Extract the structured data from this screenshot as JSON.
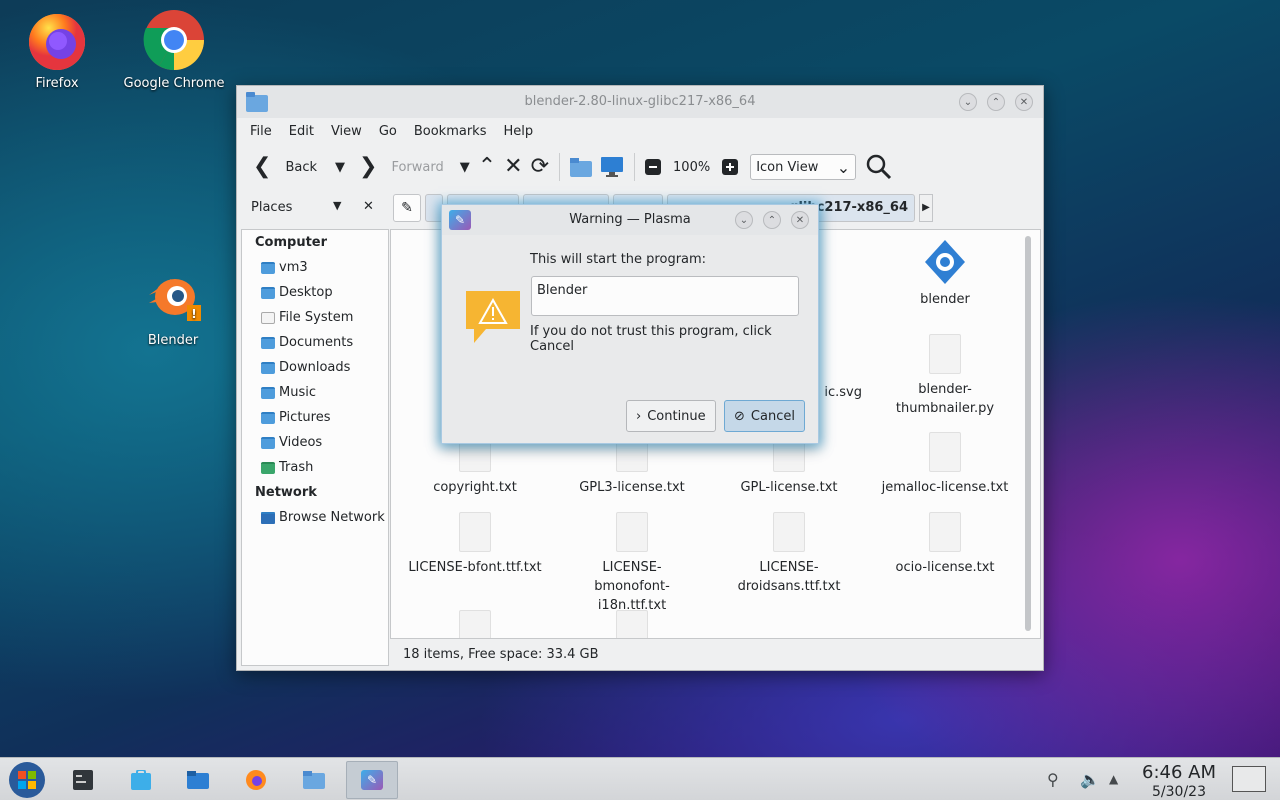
{
  "desktop": {
    "icons": [
      {
        "label": "Firefox"
      },
      {
        "label": "Google Chrome"
      },
      {
        "label": "Blender"
      }
    ]
  },
  "window": {
    "title": "blender-2.80-linux-glibc217-x86_64",
    "menu": [
      "File",
      "Edit",
      "View",
      "Go",
      "Bookmarks",
      "Help"
    ],
    "toolbar": {
      "back": "Back",
      "forward": "Forward",
      "zoom": "100%",
      "view_mode": "Icon View"
    },
    "places": {
      "header": "Places",
      "sections": [
        {
          "title": "Computer",
          "items": [
            "vm3",
            "Desktop",
            "File System",
            "Documents",
            "Downloads",
            "Music",
            "Pictures",
            "Videos",
            "Trash"
          ]
        },
        {
          "title": "Network",
          "items": [
            "Browse Network"
          ]
        }
      ]
    },
    "breadcrumb_tail": "glibc217-x86_64",
    "files": [
      {
        "name": "blender"
      },
      {
        "name": "ic.svg"
      },
      {
        "name": "blender-thumbnailer.py"
      },
      {
        "name": "copyright.txt"
      },
      {
        "name": "GPL3-license.txt"
      },
      {
        "name": "GPL-license.txt"
      },
      {
        "name": "jemalloc-license.txt"
      },
      {
        "name": "LICENSE-bfont.ttf.txt"
      },
      {
        "name": "LICENSE-bmonofont-i18n.ttf.txt"
      },
      {
        "name": "LICENSE-droidsans.ttf.txt"
      },
      {
        "name": "ocio-license.txt"
      }
    ],
    "status": "18 items, Free space: 33.4 GB"
  },
  "dialog": {
    "title": "Warning — Plasma",
    "message": "This will start the program:",
    "program": "Blender",
    "trust_note": "If you do not trust this program, click Cancel",
    "continue_label": "Continue",
    "cancel_label": "Cancel"
  },
  "taskbar": {
    "time": "6:46 AM",
    "date": "5/30/23"
  }
}
